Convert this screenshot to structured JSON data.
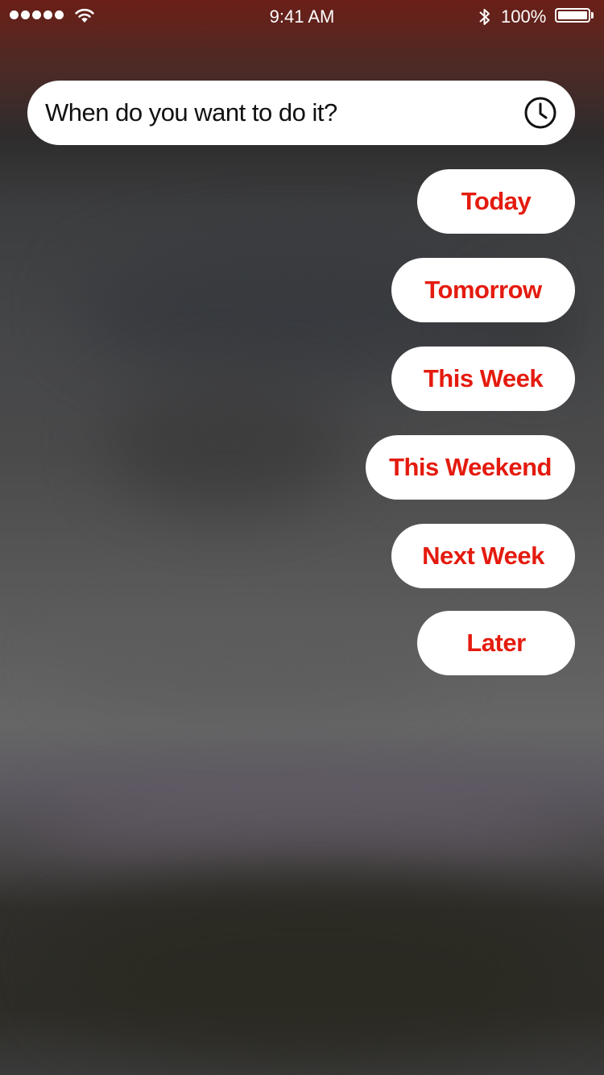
{
  "status_bar": {
    "time": "9:41 AM",
    "battery_percent": "100%",
    "icons": [
      "signal-dots-icon",
      "wifi-icon",
      "bluetooth-icon",
      "battery-icon"
    ]
  },
  "prompt": {
    "text": "When do you want to do it?",
    "icon": "clock-icon"
  },
  "options": [
    {
      "label": "Today"
    },
    {
      "label": "Tomorrow"
    },
    {
      "label": "This Week"
    },
    {
      "label": "This Weekend"
    },
    {
      "label": "Next Week"
    },
    {
      "label": "Later"
    }
  ],
  "colors": {
    "accent": "#e41b0f",
    "pill_background": "#ffffff",
    "header_tint": "#6b1f17"
  }
}
